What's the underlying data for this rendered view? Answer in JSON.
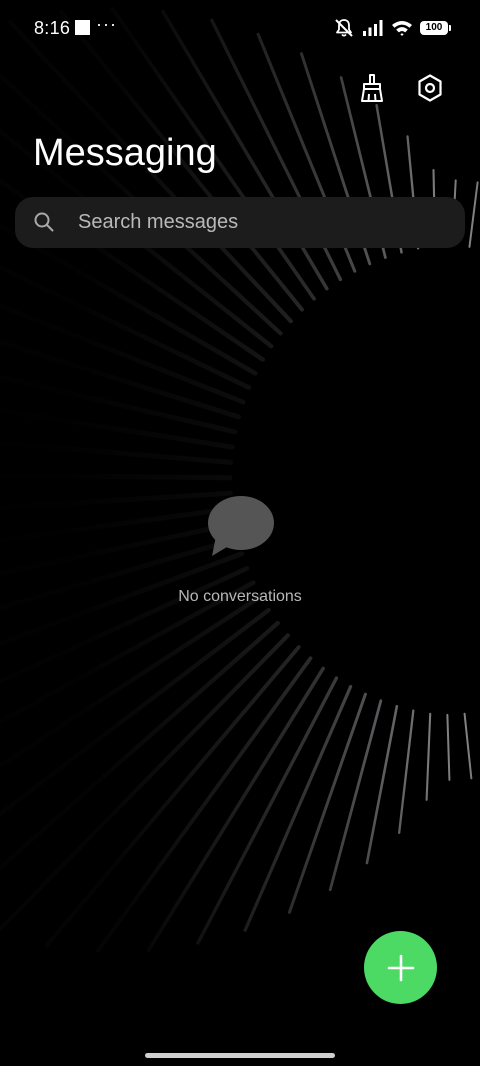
{
  "status_bar": {
    "time": "8:16",
    "more_indicator": "···",
    "battery_level": "100",
    "icons": [
      "notification-square-icon",
      "silent-mode-icon",
      "cellular-signal-icon",
      "wifi-icon",
      "battery-icon"
    ]
  },
  "header": {
    "title": "Messaging",
    "actions": [
      {
        "name": "clean-up-button",
        "icon": "broom-icon"
      },
      {
        "name": "settings-button",
        "icon": "gear-icon"
      }
    ]
  },
  "search": {
    "placeholder": "Search messages",
    "icon": "search-icon"
  },
  "empty_state": {
    "icon": "chat-bubble-icon",
    "text": "No conversations"
  },
  "fab": {
    "icon": "plus-icon",
    "color": "#4CD964"
  },
  "colors": {
    "background": "#000000",
    "search_background": "#1C1C1C",
    "accent": "#4CD964",
    "muted_text": "#B8B8B8"
  }
}
